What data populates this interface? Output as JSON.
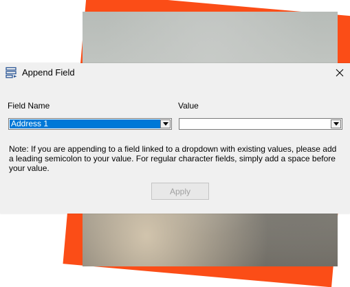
{
  "dialog": {
    "title": "Append Field",
    "title_icon": "field-list-icon",
    "close_icon": "close-icon",
    "field_name_label": "Field Name",
    "value_label": "Value",
    "field_name_selected": "Address 1",
    "value_selected": "",
    "note": "Note: If you are appending to a field linked to a dropdown with existing values, please add a leading semicolon to your value. For regular character fields, simply add a space before your value.",
    "apply_label": "Apply"
  },
  "colors": {
    "accent_orange": "#fb4d17",
    "selection_blue": "#0078d7",
    "dialog_bg": "#f0f0f0"
  }
}
